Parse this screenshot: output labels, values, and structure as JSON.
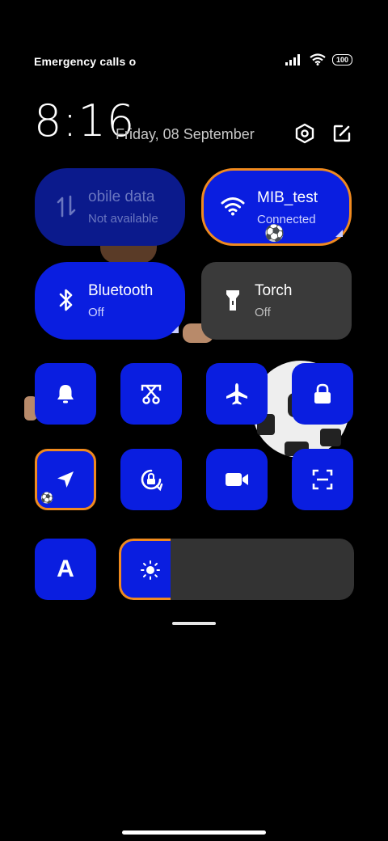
{
  "status_bar": {
    "carrier_text": "Emergency calls o",
    "battery_level": "100",
    "signal_icon": "signal-bars-icon",
    "wifi_icon": "wifi-icon"
  },
  "header": {
    "time": "8:16",
    "date": "Friday, 08 September",
    "settings_icon": "settings-hex-icon",
    "edit_icon": "edit-icon"
  },
  "tiles": {
    "mobile_data": {
      "title": "obile data",
      "subtitle": "Not available",
      "state": "unavailable"
    },
    "wifi": {
      "title": "MIB_test",
      "subtitle": "Connected",
      "state": "on"
    },
    "bluetooth": {
      "title": "Bluetooth",
      "subtitle": "Off",
      "state": "off"
    },
    "torch": {
      "title": "Torch",
      "subtitle": "Off",
      "state": "off"
    }
  },
  "small_tiles": [
    {
      "name": "ring-mode",
      "icon": "bell-icon"
    },
    {
      "name": "screenshot",
      "icon": "scissors-icon"
    },
    {
      "name": "airplane-mode",
      "icon": "airplane-icon"
    },
    {
      "name": "lock-screen",
      "icon": "lock-icon"
    },
    {
      "name": "location",
      "icon": "location-arrow-icon"
    },
    {
      "name": "auto-rotate",
      "icon": "rotate-lock-icon"
    },
    {
      "name": "screen-recorder",
      "icon": "video-camera-icon"
    },
    {
      "name": "scanner",
      "icon": "scan-icon"
    },
    {
      "name": "font-size",
      "icon": "font-a-icon",
      "label": "A"
    }
  ],
  "brightness": {
    "level_percent": 22
  },
  "colors": {
    "accent": "#0a1ee0",
    "highlight": "#f08a1f",
    "off_tile": "#3a3a3a"
  }
}
